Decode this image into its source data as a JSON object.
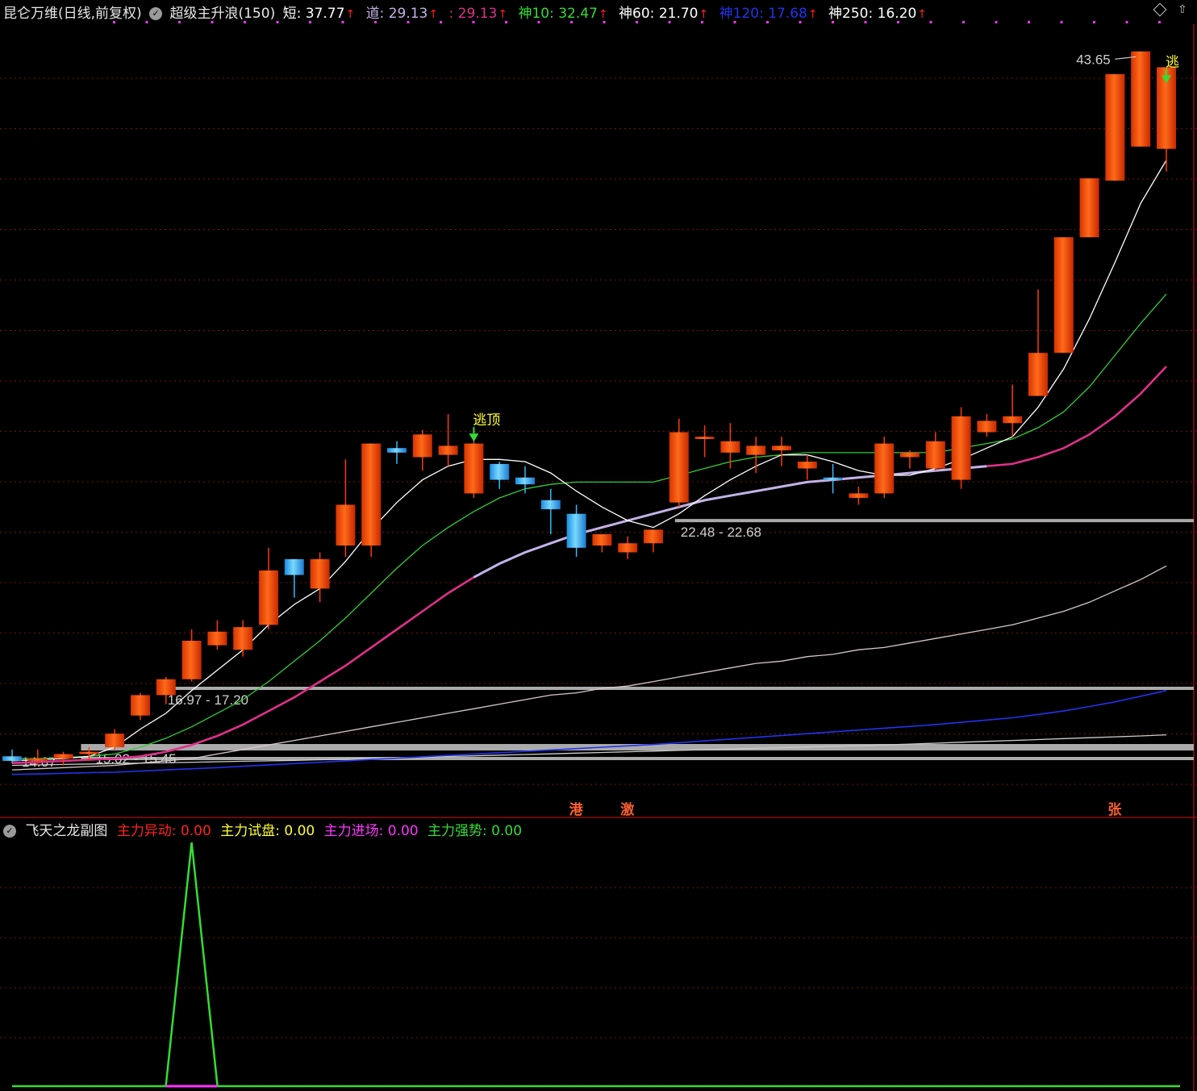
{
  "header": {
    "stock": "昆仑万维(日线,前复权)",
    "indicator": "超级主升浪(150)",
    "items": [
      {
        "label": "短: ",
        "value": "37.77",
        "color": "#ffffff"
      },
      {
        "label": "道: ",
        "value": "29.13",
        "color": "#c4b2e8"
      },
      {
        "label": ": ",
        "value": "29.13",
        "color": "#e0308a"
      },
      {
        "label": "神10: ",
        "value": "32.47",
        "color": "#33dd33"
      },
      {
        "label": "神60: ",
        "value": "21.70",
        "color": "#ffffff"
      },
      {
        "label": "神120: ",
        "value": "17.68",
        "color": "#2233ee"
      },
      {
        "label": "神250: ",
        "value": "16.20",
        "color": "#ffffff"
      }
    ]
  },
  "sub_header": {
    "title": "飞天之龙副图",
    "items": [
      {
        "label": "主力异动: ",
        "value": "0.00",
        "color": "#ff2222"
      },
      {
        "label": "主力试盘: ",
        "value": "0.00",
        "color": "#ffff33"
      },
      {
        "label": "主力进场: ",
        "value": "0.00",
        "color": "#ff33ff"
      },
      {
        "label": "主力强势: ",
        "value": "0.00",
        "color": "#33dd33"
      }
    ]
  },
  "chart_data": [
    {
      "type": "candlestick",
      "ylim": [
        12.5,
        46.5
      ],
      "max_label": "43.65",
      "candles": [
        [
          14.2,
          14.5,
          13.9,
          14.0
        ],
        [
          14.0,
          14.5,
          13.8,
          14.1
        ],
        [
          14.1,
          14.4,
          13.8,
          14.3
        ],
        [
          14.3,
          14.6,
          14.0,
          14.4
        ],
        [
          14.6,
          15.4,
          14.5,
          15.2
        ],
        [
          16.0,
          17.0,
          15.8,
          16.9
        ],
        [
          16.9,
          17.7,
          16.5,
          17.6
        ],
        [
          17.6,
          19.8,
          17.5,
          19.3
        ],
        [
          19.1,
          20.2,
          18.9,
          19.7
        ],
        [
          18.9,
          20.2,
          18.6,
          19.9
        ],
        [
          20.0,
          23.4,
          19.8,
          22.4
        ],
        [
          22.9,
          22.9,
          21.2,
          22.2
        ],
        [
          21.6,
          23.2,
          21.0,
          22.9
        ],
        [
          23.5,
          27.3,
          23.0,
          25.3
        ],
        [
          23.5,
          28.0,
          23.0,
          28.0
        ],
        [
          27.8,
          28.1,
          27.1,
          27.6
        ],
        [
          27.4,
          28.6,
          26.8,
          28.4
        ],
        [
          27.5,
          29.3,
          27.0,
          27.9
        ],
        [
          25.8,
          28.3,
          25.6,
          28.0
        ],
        [
          27.1,
          27.2,
          26.0,
          26.4
        ],
        [
          26.5,
          27.0,
          25.8,
          26.2
        ],
        [
          25.5,
          26.0,
          24.0,
          25.1
        ],
        [
          24.9,
          25.3,
          23.0,
          23.4
        ],
        [
          23.5,
          24.0,
          23.2,
          24.0
        ],
        [
          23.2,
          23.9,
          22.9,
          23.6
        ],
        [
          23.6,
          24.2,
          23.2,
          24.2
        ],
        [
          25.4,
          29.1,
          25.2,
          28.5
        ],
        [
          28.2,
          28.8,
          27.4,
          28.3
        ],
        [
          27.6,
          28.9,
          26.9,
          28.1
        ],
        [
          27.5,
          28.3,
          26.7,
          27.9
        ],
        [
          27.7,
          28.3,
          27.0,
          27.9
        ],
        [
          26.9,
          27.5,
          26.4,
          27.2
        ],
        [
          26.5,
          27.1,
          25.8,
          26.4
        ],
        [
          25.6,
          26.1,
          25.3,
          25.8
        ],
        [
          25.8,
          28.3,
          25.6,
          28.0
        ],
        [
          27.4,
          27.7,
          26.9,
          27.6
        ],
        [
          26.9,
          28.5,
          26.8,
          28.1
        ],
        [
          26.4,
          29.6,
          26.0,
          29.2
        ],
        [
          28.5,
          29.3,
          28.3,
          29.0
        ],
        [
          28.9,
          30.6,
          28.3,
          29.2
        ],
        [
          30.1,
          34.8,
          30.1,
          32.0
        ],
        [
          32.0,
          35.2,
          32.0,
          37.1
        ],
        [
          37.1,
          38.9,
          37.1,
          39.7
        ],
        [
          39.6,
          42.0,
          39.6,
          44.3
        ],
        [
          41.1,
          45.0,
          41.1,
          45.3
        ],
        [
          41.0,
          44.1,
          40.0,
          44.6
        ]
      ],
      "ma_short": [
        14.0,
        14.05,
        14.1,
        14.2,
        14.6,
        15.4,
        16.1,
        17.1,
        18.0,
        18.9,
        20.0,
        20.9,
        21.6,
        22.8,
        24.2,
        25.4,
        26.4,
        27.0,
        27.3,
        27.3,
        27.2,
        26.7,
        25.9,
        25.2,
        24.6,
        24.3,
        24.9,
        25.7,
        26.4,
        27.0,
        27.5,
        27.5,
        27.2,
        26.8,
        26.6,
        26.6,
        26.9,
        27.3,
        27.8,
        28.3,
        29.6,
        31.3,
        33.5,
        36.0,
        38.6,
        40.5
      ],
      "ma_green": [
        14.1,
        14.1,
        14.15,
        14.2,
        14.3,
        14.6,
        15.0,
        15.5,
        16.1,
        16.7,
        17.5,
        18.4,
        19.3,
        20.3,
        21.4,
        22.5,
        23.5,
        24.3,
        25.0,
        25.6,
        26.0,
        26.2,
        26.3,
        26.3,
        26.3,
        26.3,
        26.6,
        26.9,
        27.2,
        27.4,
        27.5,
        27.6,
        27.6,
        27.6,
        27.6,
        27.6,
        27.6,
        27.8,
        28.0,
        28.2,
        28.7,
        29.4,
        30.5,
        31.9,
        33.3,
        34.6
      ],
      "ma_pink_split": 17,
      "ma_pink": [
        13.9,
        13.95,
        14.0,
        14.05,
        14.1,
        14.2,
        14.4,
        14.7,
        15.1,
        15.6,
        16.2,
        16.8,
        17.5,
        18.2,
        19.0,
        19.8,
        20.6,
        21.4,
        22.1,
        22.7,
        23.2,
        23.6,
        24.0,
        24.3,
        24.6,
        24.9,
        25.2,
        25.5,
        25.7,
        25.9,
        26.1,
        26.3,
        26.4,
        26.5,
        26.6,
        26.7,
        26.8,
        26.9,
        27.0,
        27.1,
        27.4,
        27.8,
        28.4,
        29.2,
        30.2,
        31.4
      ],
      "ma60": [
        13.6,
        13.65,
        13.7,
        13.75,
        13.8,
        13.9,
        14.0,
        14.1,
        14.3,
        14.5,
        14.7,
        14.9,
        15.1,
        15.3,
        15.5,
        15.7,
        15.9,
        16.1,
        16.3,
        16.5,
        16.7,
        16.9,
        17.0,
        17.2,
        17.3,
        17.5,
        17.7,
        17.9,
        18.1,
        18.3,
        18.4,
        18.6,
        18.7,
        18.9,
        19.0,
        19.2,
        19.4,
        19.6,
        19.8,
        20.0,
        20.3,
        20.6,
        21.0,
        21.5,
        22.0,
        22.6
      ],
      "ma120": [
        13.4,
        13.42,
        13.45,
        13.48,
        13.5,
        13.55,
        13.6,
        13.65,
        13.7,
        13.76,
        13.82,
        13.88,
        13.94,
        14.0,
        14.06,
        14.12,
        14.18,
        14.24,
        14.3,
        14.36,
        14.42,
        14.48,
        14.54,
        14.6,
        14.66,
        14.72,
        14.8,
        14.88,
        14.96,
        15.04,
        15.12,
        15.2,
        15.28,
        15.36,
        15.44,
        15.52,
        15.6,
        15.7,
        15.8,
        15.9,
        16.05,
        16.2,
        16.4,
        16.6,
        16.85,
        17.1
      ],
      "ma250": [
        13.8,
        13.82,
        13.84,
        13.86,
        13.88,
        13.9,
        13.92,
        13.94,
        13.96,
        13.98,
        14.0,
        14.02,
        14.05,
        14.08,
        14.1,
        14.13,
        14.16,
        14.19,
        14.22,
        14.25,
        14.28,
        14.31,
        14.34,
        14.37,
        14.4,
        14.43,
        14.46,
        14.49,
        14.52,
        14.55,
        14.58,
        14.61,
        14.64,
        14.67,
        14.7,
        14.74,
        14.78,
        14.82,
        14.86,
        14.9,
        14.94,
        14.98,
        15.02,
        15.06,
        15.1,
        15.15
      ],
      "zones": [
        {
          "label": "14.67",
          "price": 14.1
        },
        {
          "label": "15.02 - 15.45",
          "price": 14.6
        },
        {
          "label": "16.97 - 17.20",
          "price": 17.2
        },
        {
          "label": "22.48 - 22.68",
          "price": 24.6
        }
      ],
      "signals": [
        {
          "label": "逃顶",
          "index": 18,
          "color": "#ffff33"
        },
        {
          "label": "逃",
          "index": 45,
          "color": "#ffff33"
        }
      ],
      "bottom_marks": [
        {
          "label": "港",
          "index": 22
        },
        {
          "label": "激",
          "index": 24
        },
        {
          "label": "张",
          "index": 43
        }
      ]
    },
    {
      "type": "line",
      "title": "飞天之龙副图",
      "spike_index": 7,
      "series": [
        {
          "name": "主力强势",
          "color": "#33dd33",
          "spike_value": 1.0
        }
      ]
    }
  ]
}
